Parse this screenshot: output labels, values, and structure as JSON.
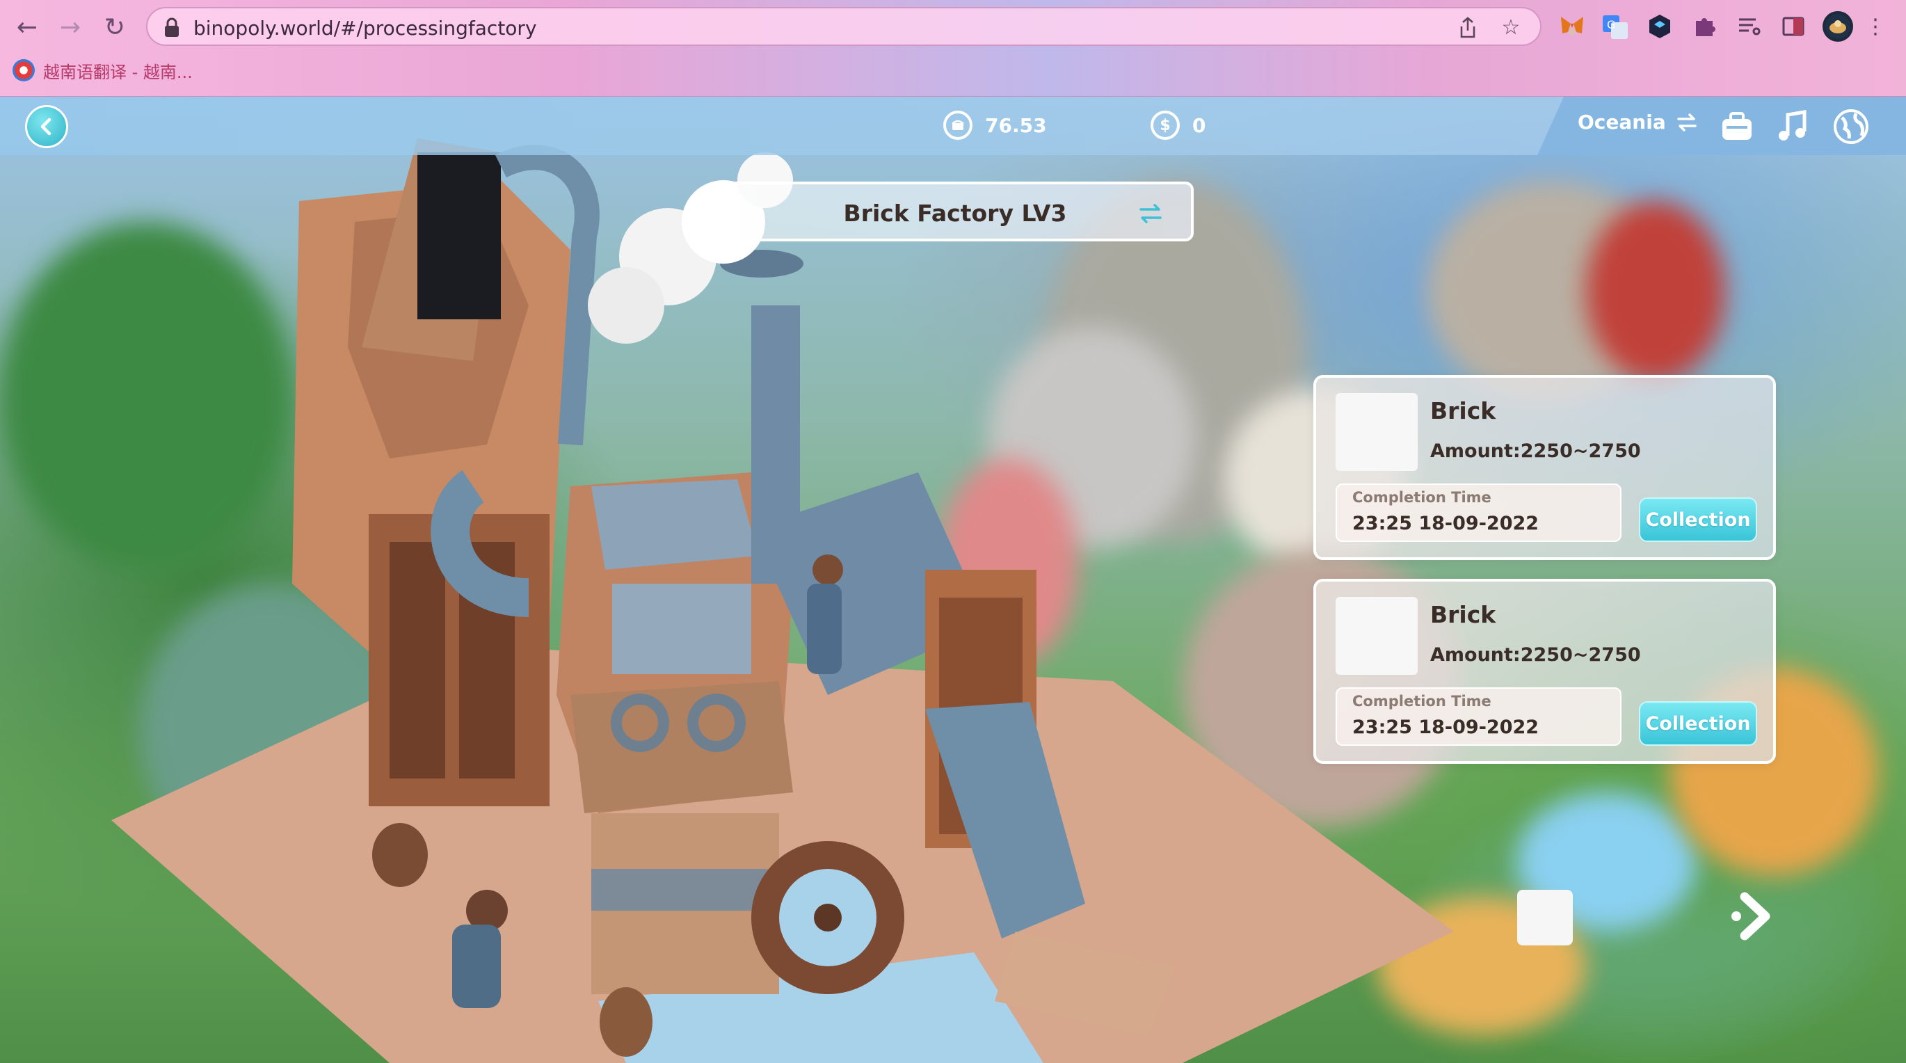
{
  "browser": {
    "url": "binopoly.world/#/processingfactory",
    "bookmark_label": "越南语翻译 - 越南...",
    "icons": [
      "back-arrow-icon",
      "forward-arrow-icon",
      "reload-icon",
      "lock-icon",
      "share-icon",
      "star-icon",
      "metamask-icon",
      "translate-icon",
      "wallet-extension-icon",
      "puzzle-icon",
      "reading-list-icon",
      "side-panel-icon",
      "profile-avatar-icon",
      "menu-dots-icon"
    ]
  },
  "hud": {
    "balance_primary": "76.53",
    "balance_secondary": "0",
    "region": "Oceania",
    "icons": [
      "back-chevron-icon",
      "chest-icon",
      "dollar-coin-icon",
      "swap-icon",
      "backpack-icon",
      "music-icon",
      "globe-icon"
    ]
  },
  "factory": {
    "title": "Brick Factory LV3"
  },
  "orders": [
    {
      "item": "Brick",
      "amount": "Amount:2250~2750",
      "completion_label": "Completion Time",
      "completion_time": "23:25 18-09-2022",
      "button_label": "Collection"
    },
    {
      "item": "Brick",
      "amount": "Amount:2250~2750",
      "completion_label": "Completion Time",
      "completion_time": "23:25 18-09-2022",
      "button_label": "Collection"
    }
  ],
  "colors": {
    "accent": "#39c4d8",
    "text_dark": "#3a2c26",
    "hud_bar": "#96c8eb"
  }
}
